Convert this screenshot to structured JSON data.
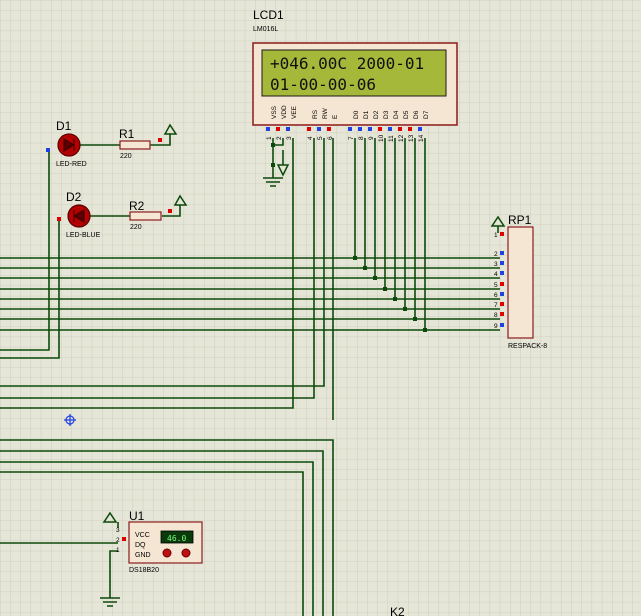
{
  "colors": {
    "background": "#e6e6d8",
    "grid": "#c9c9b8",
    "wire": "#0b4a0b",
    "component_body": "#f5e6d3",
    "component_border": "#8b1a1a",
    "lcd_screen": "#a5b83a",
    "lcd_frame": "#8b1a1a",
    "led_red": "#b30000",
    "pin_red": "#e00000",
    "pin_blue": "#2040e0"
  },
  "lcd": {
    "ref": "LCD1",
    "part": "LM016L",
    "line1": "+046.00C 2000-01",
    "line2": "01-00-00-06",
    "pin_names": [
      "VSS",
      "VDD",
      "VEE",
      "RS",
      "RW",
      "E",
      "D0",
      "D1",
      "D2",
      "D3",
      "D4",
      "D5",
      "D6",
      "D7"
    ],
    "pin_numbers": [
      "1",
      "2",
      "3",
      "4",
      "5",
      "6",
      "7",
      "8",
      "9",
      "10",
      "11",
      "12",
      "13",
      "14"
    ]
  },
  "d1": {
    "ref": "D1",
    "part": "LED-RED",
    "icon": "led-icon"
  },
  "d2": {
    "ref": "D2",
    "part": "LED-BLUE",
    "icon": "led-icon"
  },
  "r1": {
    "ref": "R1",
    "value": "220"
  },
  "r2": {
    "ref": "R2",
    "value": "220"
  },
  "rp1": {
    "ref": "RP1",
    "part": "RESPACK-8",
    "pins": [
      "1",
      "2",
      "3",
      "4",
      "5",
      "6",
      "7",
      "8",
      "9"
    ]
  },
  "u1": {
    "ref": "U1",
    "part": "DS18B20",
    "pins": [
      "VCC",
      "DQ",
      "GND"
    ],
    "pin_numbers": [
      "3",
      "2",
      "1"
    ],
    "display": "46.0"
  },
  "k2": {
    "ref": "K2"
  },
  "icons": [
    "power-terminal-icon",
    "ground-icon",
    "probe-marker-icon"
  ]
}
